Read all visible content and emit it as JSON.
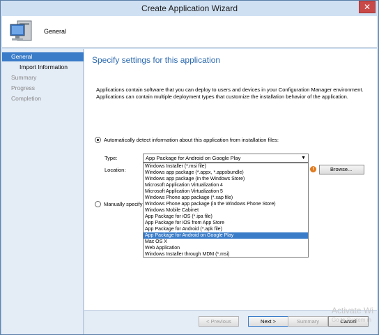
{
  "window": {
    "title": "Create Application Wizard",
    "close_glyph": "✕"
  },
  "header": {
    "icon": "computer-icon",
    "page_name": "General"
  },
  "sidebar": {
    "items": [
      {
        "label": "General",
        "state": "active"
      },
      {
        "label": "Import Information",
        "state": "sub"
      },
      {
        "label": "Summary",
        "state": "inactive"
      },
      {
        "label": "Progress",
        "state": "inactive"
      },
      {
        "label": "Completion",
        "state": "inactive"
      }
    ]
  },
  "content": {
    "heading": "Specify settings for this application",
    "description_line1": "Applications contain software that you can deploy to users and devices in your Configuration Manager environment.",
    "description_line2": "Applications can contain multiple deployment types that customize the installation behavior of the application.",
    "auto_detect_label": "Automatically detect information about this application from installation files:",
    "type_label": "Type:",
    "location_label": "Location:",
    "type_selected": "App Package for Android on Google Play",
    "manual_label_visible": "Manually specify t",
    "browse_label": "Browse...",
    "warning_glyph": "!",
    "type_options": [
      "Windows Installer (*.msi file)",
      "Windows app package (*.appx, *.appxbundle)",
      "Windows app package (in the Windows Store)",
      "Microsoft Application Virtualization 4",
      "Microsoft Application Virtualization 5",
      "Windows Phone app package (*.xap file)",
      "Windows Phone app package (in the Windows Phone Store)",
      "Windows Mobile Cabinet",
      "App Package for iOS (*.ipa file)",
      "App Package for iOS from App Store",
      "App Package for Android (*.apk file)",
      "App Package for Android on Google Play",
      "Mac OS X",
      "Web Application",
      "Windows Installer through MDM (*.msi)"
    ],
    "selected_option_index": 11
  },
  "footer": {
    "previous_label": "< Previous",
    "next_label": "Next >",
    "summary_label": "Summary",
    "cancel_label": "Cancel"
  },
  "watermark": {
    "line1": "Activate Wi",
    "line2": "Go to System in"
  },
  "colors": {
    "accent": "#3a7cc8",
    "heading": "#2d6ab0",
    "chrome": "#cfe0f3"
  }
}
